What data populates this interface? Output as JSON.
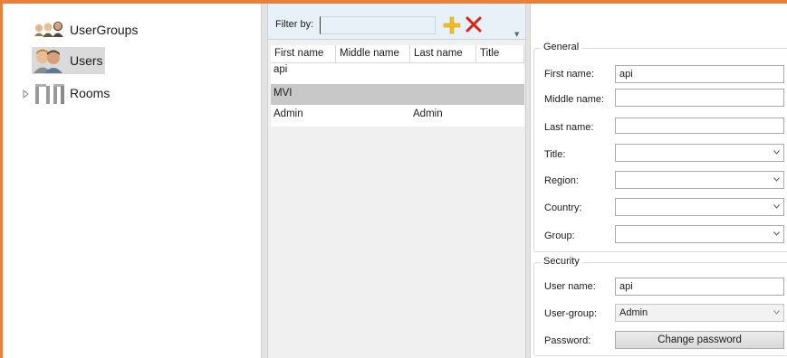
{
  "tree": {
    "items": [
      {
        "label": "UserGroups",
        "icon": "user-groups-icon"
      },
      {
        "label": "Users",
        "icon": "users-icon",
        "selected": true
      },
      {
        "label": "Rooms",
        "icon": "rooms-icon",
        "expandable": true
      }
    ]
  },
  "filter": {
    "label": "Filter by:",
    "value": ""
  },
  "grid": {
    "columns": [
      "First name",
      "Middle name",
      "Last name",
      "Title"
    ],
    "rows": [
      {
        "first": "api",
        "middle": "",
        "last": "",
        "title": ""
      },
      {
        "first": "MVI",
        "middle": "",
        "last": "",
        "title": ""
      },
      {
        "first": "Admin",
        "middle": "",
        "last": "Admin",
        "title": ""
      }
    ],
    "selected_row": 1
  },
  "details": {
    "general": {
      "title": "General",
      "first_name_label": "First name:",
      "first_name_value": "api",
      "middle_name_label": "Middle name:",
      "middle_name_value": "",
      "last_name_label": "Last name:",
      "last_name_value": "",
      "title_label": "Title:",
      "title_value": "",
      "region_label": "Region:",
      "region_value": "",
      "country_label": "Country:",
      "country_value": "",
      "group_label": "Group:",
      "group_value": ""
    },
    "security": {
      "title": "Security",
      "user_name_label": "User name:",
      "user_name_value": "api",
      "user_group_label": "User-group:",
      "user_group_value": "Admin",
      "password_label": "Password:",
      "change_password_label": "Change password"
    }
  },
  "colors": {
    "accent": "#e8803a",
    "add": "#f0c020",
    "delete": "#e02010",
    "selection": "#c8c8c8"
  }
}
